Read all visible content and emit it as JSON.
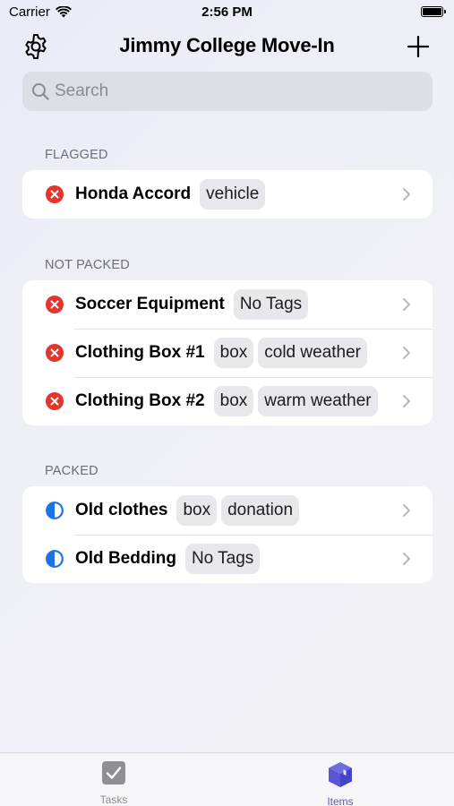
{
  "status_bar": {
    "carrier": "Carrier",
    "time": "2:56 PM"
  },
  "nav": {
    "title": "Jimmy College Move-In",
    "left_icon": "gear-icon",
    "right_icon": "plus-icon"
  },
  "search": {
    "placeholder": "Search",
    "value": ""
  },
  "sections": {
    "flagged": {
      "header": "FLAGGED",
      "items": [
        {
          "name": "Honda Accord",
          "status": "not-packed",
          "tags": [
            "vehicle"
          ]
        }
      ]
    },
    "not_packed": {
      "header": "NOT PACKED",
      "items": [
        {
          "name": "Soccer Equipment",
          "status": "not-packed",
          "tags": [
            "No Tags"
          ]
        },
        {
          "name": "Clothing Box #1",
          "status": "not-packed",
          "tags": [
            "box",
            "cold weather"
          ]
        },
        {
          "name": "Clothing Box #2",
          "status": "not-packed",
          "tags": [
            "box",
            "warm weather"
          ]
        }
      ]
    },
    "packed": {
      "header": "PACKED",
      "items": [
        {
          "name": "Old clothes",
          "status": "half-packed",
          "tags": [
            "box",
            "donation"
          ]
        },
        {
          "name": "Old Bedding",
          "status": "half-packed",
          "tags": [
            "No Tags"
          ]
        }
      ]
    }
  },
  "tab_bar": {
    "tabs": [
      {
        "label": "Tasks",
        "icon": "checkbox-icon",
        "selected": false
      },
      {
        "label": "Items",
        "icon": "cube-icon",
        "selected": true
      }
    ]
  },
  "colors": {
    "accent": "#5856d6",
    "not_packed": "#e5342c",
    "half_packed": "#1a73e8",
    "inactive_tab": "#8e8e93"
  }
}
